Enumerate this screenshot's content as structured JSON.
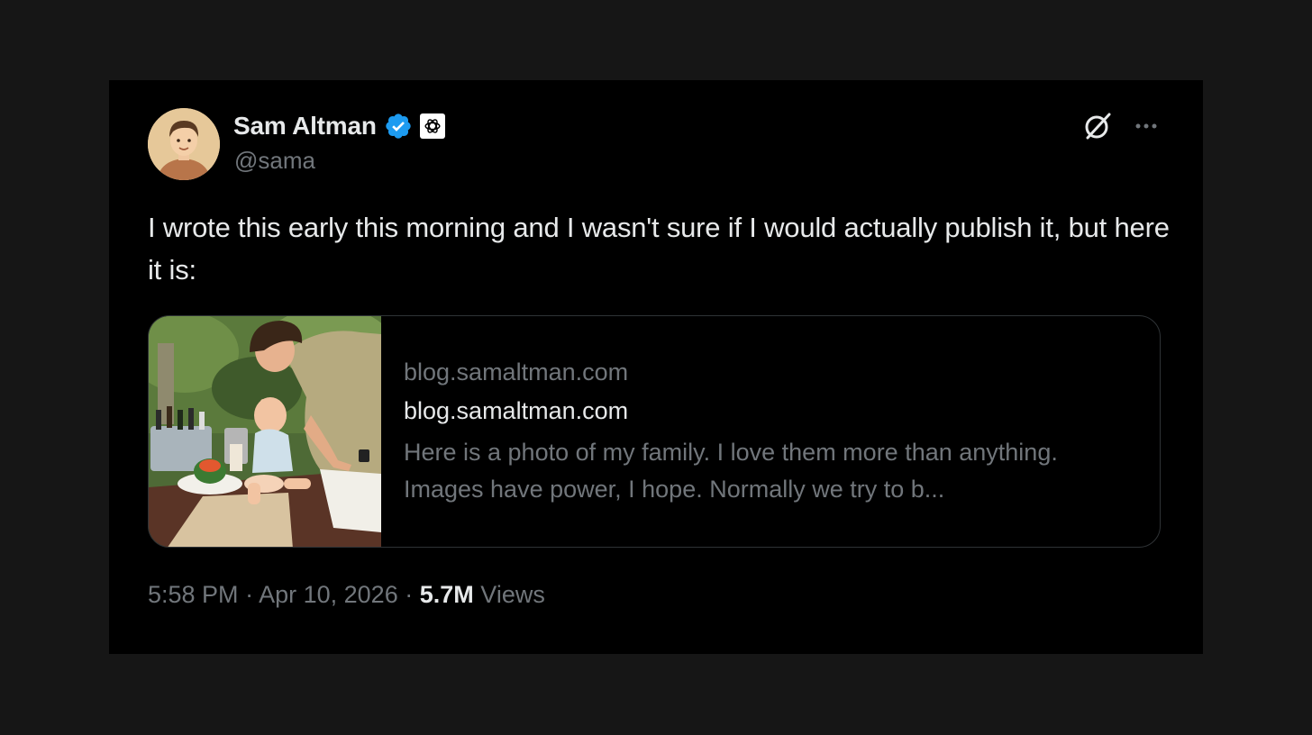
{
  "author": {
    "display_name": "Sam Altman",
    "handle": "@sama",
    "verified": true,
    "affiliate_badge": "openai-logo-icon"
  },
  "header_actions": {
    "grok_icon": "grok-icon",
    "more_icon": "more-icon"
  },
  "tweet": {
    "text": "I wrote this early this morning and I wasn't sure if I would actually publish it, but here it is:"
  },
  "link_card": {
    "domain": "blog.samaltman.com",
    "title": "blog.samaltman.com",
    "description": "Here is a photo of my family. I love them more than anything. Images have power, I hope. Normally we try to b..."
  },
  "meta": {
    "time": "5:58 PM",
    "separator": "·",
    "date": "Apr 10, 2026",
    "views_count": "5.7M",
    "views_label": "Views"
  },
  "colors": {
    "background": "#161616",
    "card": "#000000",
    "text_primary": "#e7e9ea",
    "text_secondary": "#71767b",
    "verified_blue": "#1d9bf0",
    "border": "#2f3336"
  }
}
